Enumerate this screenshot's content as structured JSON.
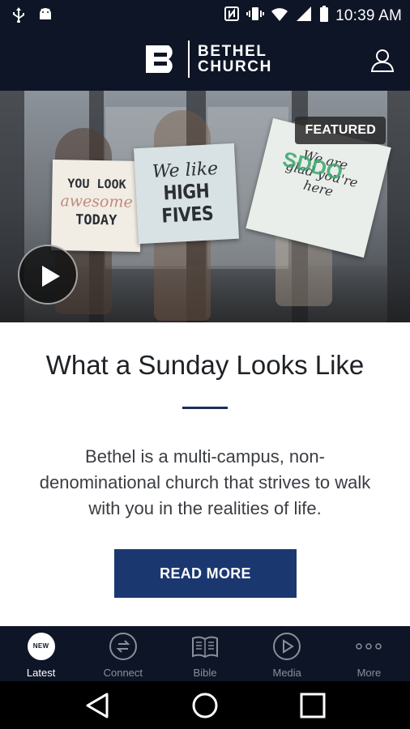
{
  "status_bar": {
    "time": "10:39 AM",
    "left_icons": [
      "usb-icon",
      "android-icon"
    ],
    "right_icons": [
      "nfc-icon",
      "vibrate-icon",
      "wifi-icon",
      "signal-icon",
      "battery-icon"
    ]
  },
  "header": {
    "logo_line1": "BETHEL",
    "logo_line2": "CHURCH",
    "logo_mark_letter": "B",
    "profile_icon": "user-icon"
  },
  "hero": {
    "badge": "FEATURED",
    "sign1": {
      "line1": "YOU LOOK",
      "line2": "awesome",
      "line3": "TODAY"
    },
    "sign2": {
      "line1": "We like",
      "line2": "HIGH FIVES"
    },
    "sign3": {
      "line1": "We are",
      "line2": "glad you're",
      "line3": "here",
      "overlay": "SDDO"
    },
    "play_icon": "play-icon"
  },
  "article": {
    "title": "What a Sunday Looks Like",
    "description": "Bethel is a multi-campus, non-denominational church that strives to walk with you in the realities of life.",
    "button_label": "READ MORE"
  },
  "tabs": [
    {
      "label": "Latest",
      "icon": "new-badge-icon",
      "badge": "NEW",
      "active": true
    },
    {
      "label": "Connect",
      "icon": "connect-icon",
      "active": false
    },
    {
      "label": "Bible",
      "icon": "bible-icon",
      "active": false
    },
    {
      "label": "Media",
      "icon": "media-icon",
      "active": false
    },
    {
      "label": "More",
      "icon": "more-icon",
      "active": false
    }
  ],
  "colors": {
    "header_bg": "#0e1526",
    "accent": "#1b3770",
    "tab_inactive": "#8a8f99"
  }
}
